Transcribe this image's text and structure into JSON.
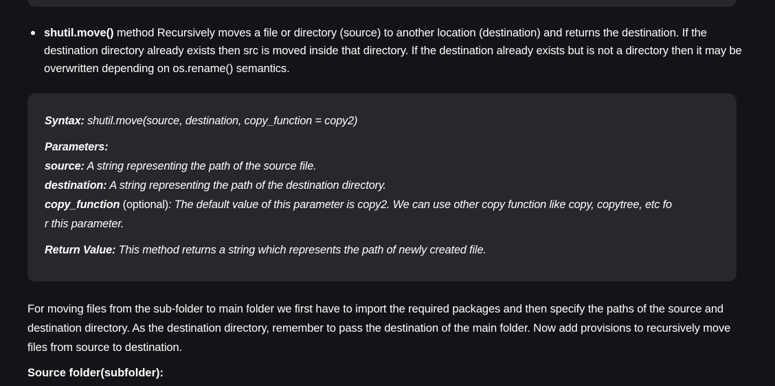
{
  "bullet": {
    "term": "shutil.move()",
    "text": " method Recursively moves a file or directory (source) to another location (destination) and returns the destination. If the destination directory already exists then src is moved inside that directory. If the destination already exists but is not a directory then it may be overwritten depending on os.rename() semantics."
  },
  "syntax": {
    "label": "Syntax:",
    "text": " shutil.move(source, destination, copy_function = copy2)",
    "params_label": "Parameters:",
    "source_label": "source:",
    "source_text": " A string representing the path of the source file.",
    "destination_label": "destination:",
    "destination_text": " A string representing the path of the destination directory.",
    "copy_label": "copy_function",
    "copy_optional": " (optional)",
    "copy_text_1": ": The default value of this parameter is copy2. We can use other copy function like copy, copytree, etc fo",
    "copy_text_2": "r this parameter.",
    "return_label": "Return Value:",
    "return_text": " This method returns a string which represents the path of newly created file."
  },
  "paragraph": "For moving files from the sub-folder to main folder we first have to import the required packages and then specify the paths of the source and destination directory. As the destination directory, remember to pass the destination of the main folder. Now add provisions to recursively move files from source to destination.",
  "subheading": "Source folder(subfolder):"
}
